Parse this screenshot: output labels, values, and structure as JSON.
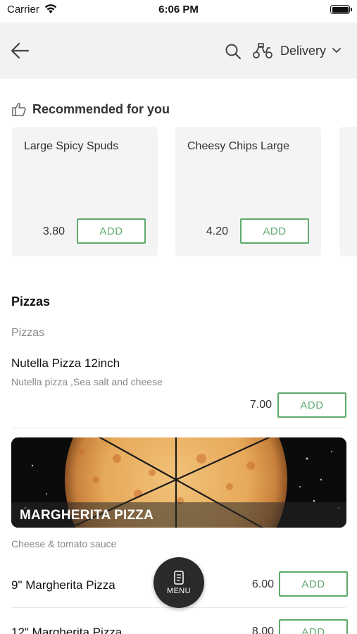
{
  "status_bar": {
    "carrier": "Carrier",
    "time": "6:06 PM"
  },
  "header": {
    "delivery_mode": "Delivery"
  },
  "recommended": {
    "title": "Recommended for you",
    "items": [
      {
        "name": "Large Spicy Spuds",
        "price": "3.80",
        "button": "ADD"
      },
      {
        "name": "Cheesy Chips Large",
        "price": "4.20",
        "button": "ADD"
      }
    ]
  },
  "menu": {
    "section_title": "Pizzas",
    "subcategory": "Pizzas",
    "items": [
      {
        "name": "Nutella Pizza 12inch",
        "description": "Nutella pizza ,Sea salt and cheese",
        "price": "7.00",
        "button": "ADD"
      }
    ],
    "banner": {
      "title": "MARGHERITA PIZZA",
      "description": "Cheese & tomato sauce"
    },
    "banner_items": [
      {
        "name": "9\" Margherita Pizza",
        "price": "6.00",
        "button": "ADD"
      },
      {
        "name": "12\" Margherita Pizza",
        "price": "8.00",
        "button": "ADD"
      }
    ]
  },
  "fab": {
    "label": "MENU"
  },
  "colors": {
    "accent": "#5cab6c",
    "header_bg": "#f2f2f2",
    "card_bg": "#f4f4f4",
    "fab_bg": "#2a2a2a"
  }
}
